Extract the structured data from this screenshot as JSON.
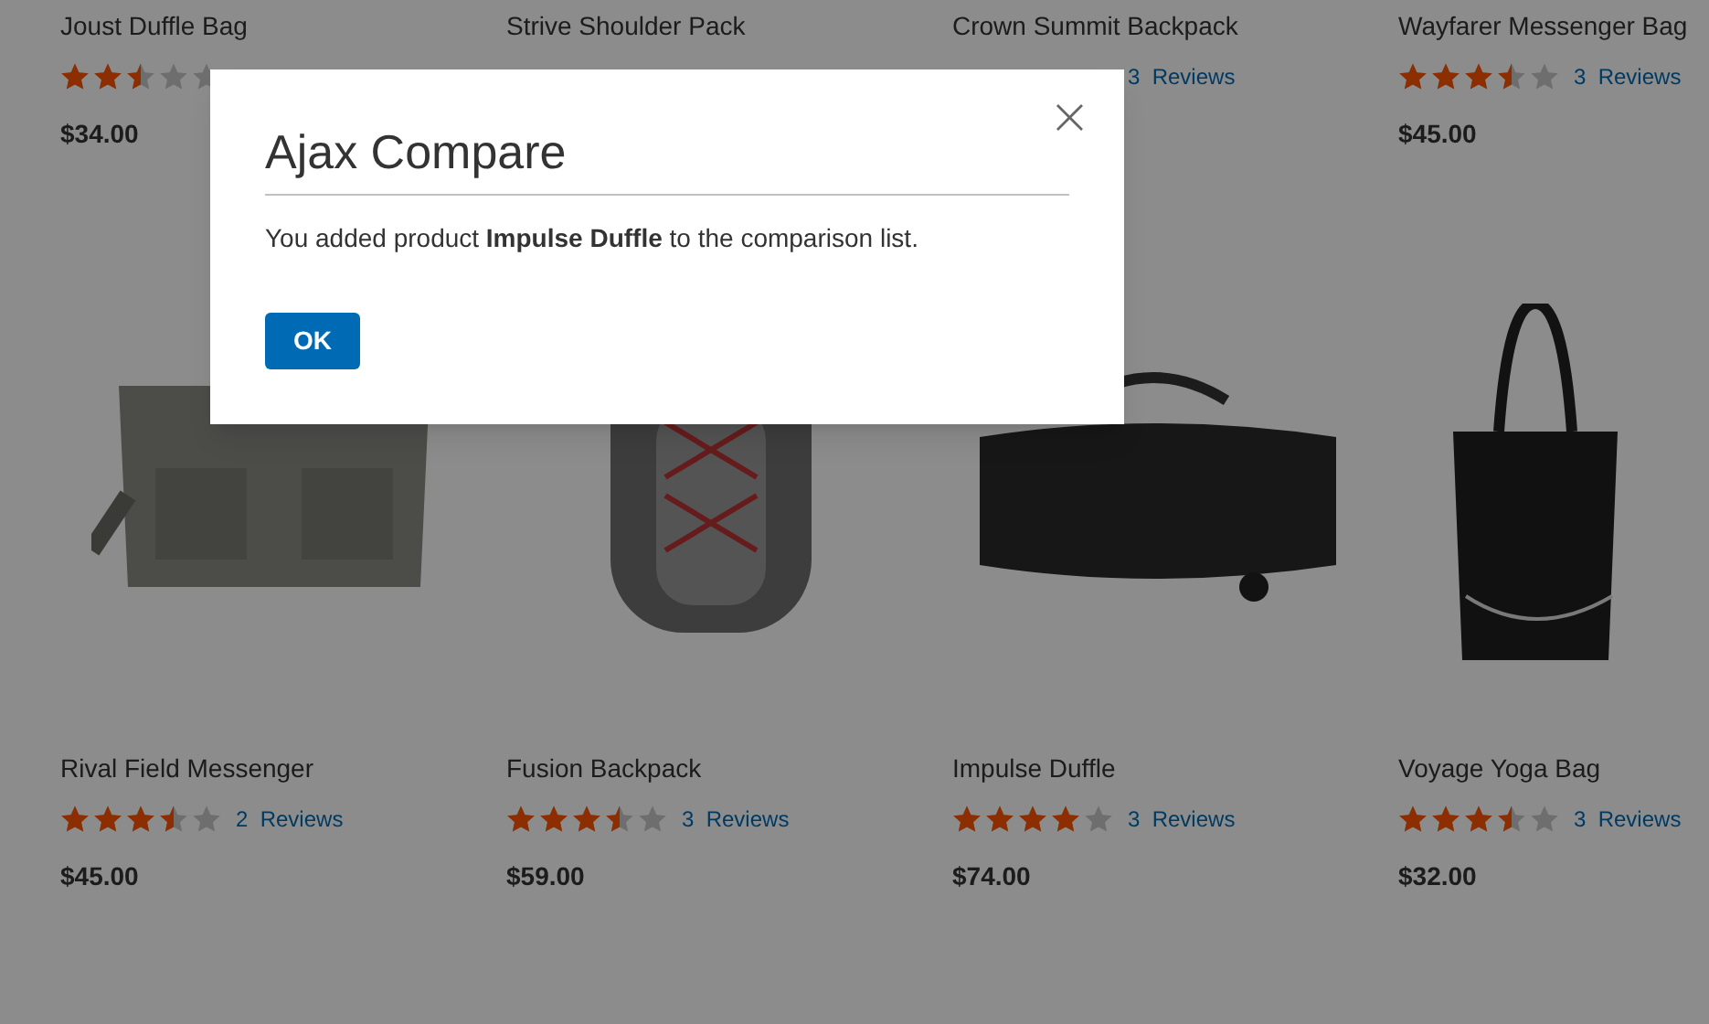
{
  "products": [
    {
      "name": "Joust Duffle Bag",
      "stars": 2.5,
      "price": "$34.00"
    },
    {
      "name": "Strive Shoulder Pack"
    },
    {
      "name": "Crown Summit Backpack",
      "review_count": "3",
      "review_label": "Reviews"
    },
    {
      "name": "Wayfarer Messenger Bag",
      "stars": 3.5,
      "review_count": "3",
      "review_label": "Reviews",
      "price": "$45.00"
    },
    {
      "name": "Rival Field Messenger",
      "stars": 3.5,
      "review_count": "2",
      "review_label": "Reviews",
      "price": "$45.00"
    },
    {
      "name": "Fusion Backpack",
      "stars": 3.5,
      "review_count": "3",
      "review_label": "Reviews",
      "price": "$59.00"
    },
    {
      "name": "Impulse Duffle",
      "stars": 4,
      "review_count": "3",
      "review_label": "Reviews",
      "price": "$74.00"
    },
    {
      "name": "Voyage Yoga Bag",
      "stars": 3.5,
      "review_count": "3",
      "review_label": "Reviews",
      "price": "$32.00"
    }
  ],
  "modal": {
    "title": "Ajax Compare",
    "close": "×",
    "message": "You added product **Impulse Duffle** to the comparison list.",
    "button": "OK"
  }
}
